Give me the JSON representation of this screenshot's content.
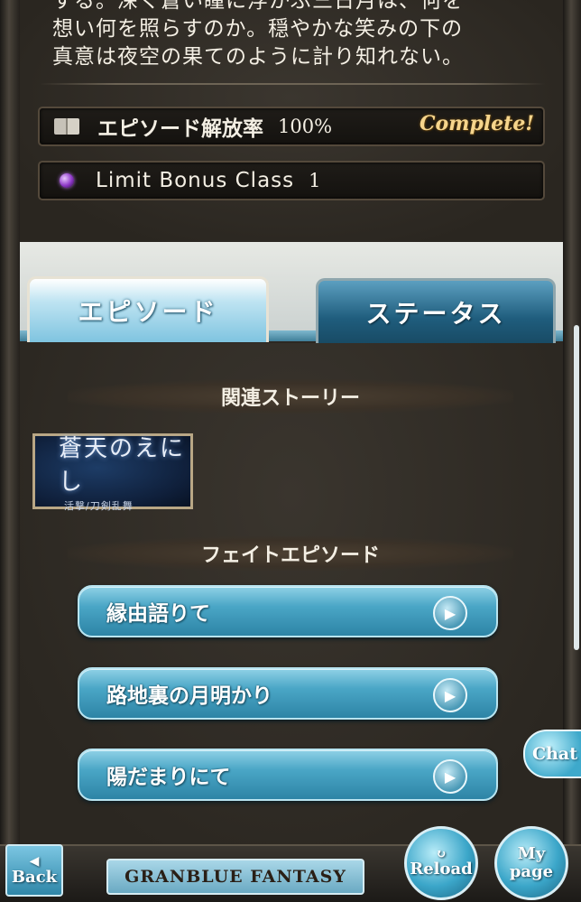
{
  "lore": {
    "text": "する。深く蒼い瞳に浮かぶ三日月は、何を\n想い何を照らすのか。穏やかな笑みの下の\n真意は夜空の果てのように計り知れない。"
  },
  "episode_rate": {
    "label": "エピソード解放率",
    "value": "100%",
    "badge": "Complete!"
  },
  "limit_bonus": {
    "label": "Limit Bonus Class",
    "value": "1"
  },
  "tabs": {
    "episode": "エピソード",
    "status": "ステータス"
  },
  "related_story": {
    "header": "関連ストーリー",
    "banner_title": "蒼天のえにし",
    "banner_subtitle": "活撃/刀剣乱舞"
  },
  "fate_episodes": {
    "header": "フェイトエピソード",
    "items": [
      {
        "label": "縁由語りて"
      },
      {
        "label": "路地裏の月明かり"
      },
      {
        "label": "陽だまりにて"
      }
    ]
  },
  "chat": {
    "label": "Chat"
  },
  "footer": {
    "back": "Back",
    "logo": "GRANBLUE FANTASY",
    "reload": "Reload",
    "my": "My",
    "page": "page"
  },
  "colors": {
    "accent": "#4aa6c6",
    "complete_gold": "#f6d58c",
    "background": "#2c2822"
  }
}
